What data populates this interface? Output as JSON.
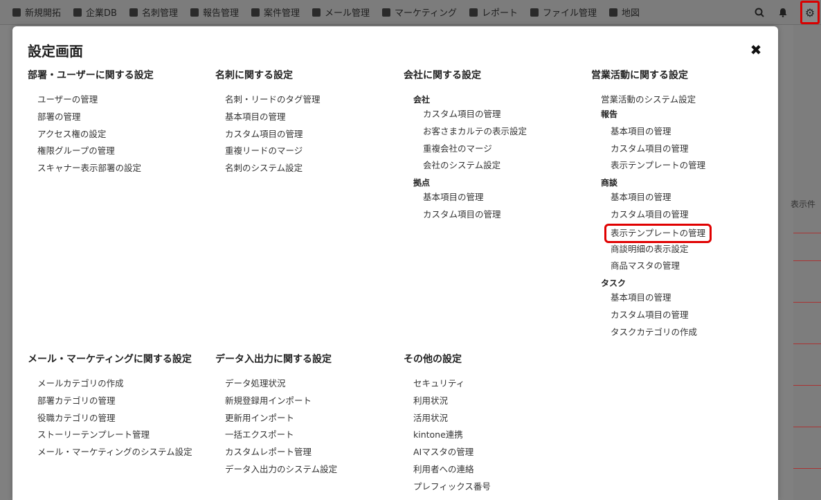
{
  "background": {
    "nav": [
      {
        "label": "新規開拓"
      },
      {
        "label": "企業DB"
      },
      {
        "label": "名刺管理"
      },
      {
        "label": "報告管理"
      },
      {
        "label": "案件管理"
      },
      {
        "label": "メール管理"
      },
      {
        "label": "マーケティング"
      },
      {
        "label": "レポート"
      },
      {
        "label": "ファイル管理"
      },
      {
        "label": "地図"
      }
    ],
    "side_text": "表示件"
  },
  "modal": {
    "title": "設定画面",
    "close": "✖",
    "sections": {
      "dept_user": {
        "title": "部署・ユーザーに関する設定",
        "items": [
          "ユーザーの管理",
          "部署の管理",
          "アクセス権の設定",
          "権限グループの管理",
          "スキャナー表示部署の設定"
        ]
      },
      "card": {
        "title": "名刺に関する設定",
        "items": [
          "名刺・リードのタグ管理",
          "基本項目の管理",
          "カスタム項目の管理",
          "重複リードのマージ",
          "名刺のシステム設定"
        ]
      },
      "company": {
        "title": "会社に関する設定",
        "groups": [
          {
            "heading": "会社",
            "items": [
              "カスタム項目の管理",
              "お客さまカルテの表示設定",
              "重複会社のマージ",
              "会社のシステム設定"
            ]
          },
          {
            "heading": "拠点",
            "items": [
              "基本項目の管理",
              "カスタム項目の管理"
            ]
          }
        ]
      },
      "sales": {
        "title": "営業活動に関する設定",
        "top_items": [
          "営業活動のシステム設定"
        ],
        "groups": [
          {
            "heading": "報告",
            "items": [
              "基本項目の管理",
              "カスタム項目の管理",
              "表示テンプレートの管理"
            ]
          },
          {
            "heading": "商談",
            "items": [
              "基本項目の管理",
              "カスタム項目の管理",
              "表示テンプレートの管理",
              "商談明細の表示設定",
              "商品マスタの管理"
            ]
          },
          {
            "heading": "タスク",
            "items": [
              "基本項目の管理",
              "カスタム項目の管理",
              "タスクカテゴリの作成"
            ]
          }
        ]
      },
      "mail": {
        "title": "メール・マーケティングに関する設定",
        "items": [
          "メールカテゴリの作成",
          "部署カテゴリの管理",
          "役職カテゴリの管理",
          "ストーリーテンプレート管理",
          "メール・マーケティングのシステム設定"
        ]
      },
      "data_io": {
        "title": "データ入出力に関する設定",
        "items": [
          "データ処理状況",
          "新規登録用インポート",
          "更新用インポート",
          "一括エクスポート",
          "カスタムレポート管理",
          "データ入出力のシステム設定"
        ]
      },
      "other": {
        "title": "その他の設定",
        "items": [
          "セキュリティ",
          "利用状況",
          "活用状況",
          "kintone連携",
          "AIマスタの管理",
          "利用者への連絡",
          "プレフィックス番号"
        ]
      }
    },
    "highlight_color": "#e00000"
  }
}
